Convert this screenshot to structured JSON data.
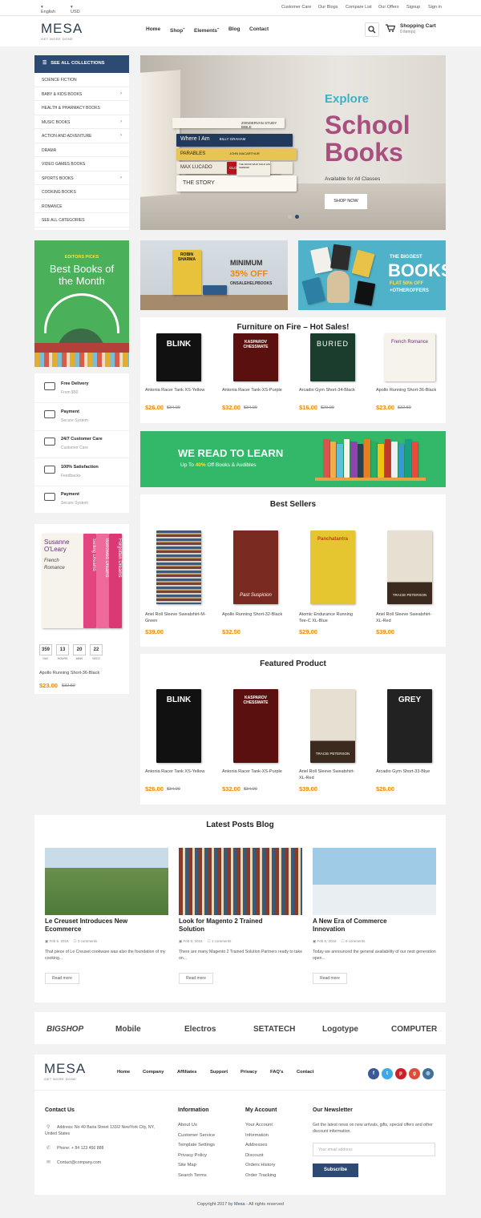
{
  "topbar": {
    "language": "English",
    "currency": "USD",
    "links": [
      "Customer Care",
      "Our Blogs",
      "Compare List",
      "Our Offers",
      "Signup",
      "Sign in"
    ]
  },
  "header": {
    "logo": "MESA",
    "tagline": "GET MORE DONE",
    "nav": [
      "Home",
      "Shop",
      "Elements",
      "Blog",
      "Contact"
    ],
    "cart_title": "Shopping Cart",
    "cart_items": "0 item(s)"
  },
  "sidebar": {
    "header": "SEE ALL COLLECTIONS",
    "categories": [
      {
        "label": "SCIENCE FICTION",
        "arrow": false
      },
      {
        "label": "BABY & KIDS BOOKS",
        "arrow": true
      },
      {
        "label": "HEALTH & PHARMACY BOOKS",
        "arrow": false
      },
      {
        "label": "MUSIC BOOKS",
        "arrow": true
      },
      {
        "label": "ACTION AND ADVENTURE",
        "arrow": true
      },
      {
        "label": "DRAMA",
        "arrow": false
      },
      {
        "label": "VIDEO GAMES BOOKS",
        "arrow": false
      },
      {
        "label": "SPORTS BOOKS",
        "arrow": true
      },
      {
        "label": "COOKING BOOKS",
        "arrow": false
      },
      {
        "label": "ROMANCE",
        "arrow": false
      },
      {
        "label": "SEE ALL CATEGORIES",
        "arrow": false
      }
    ]
  },
  "hero": {
    "line1": "Explore",
    "line2": "School",
    "line3": "Books",
    "sub": "Available for All Classes",
    "button": "SHOP NOW",
    "spines": [
      "ZONDERVAN STUDY BIBLE",
      "Where I Am",
      "BILLY GRAHAM",
      "PARABLES",
      "JOHN MACARTHUR",
      "MAX LUCADO",
      "GLORY DAYS",
      "THE STORY",
      "THE MONK WHO SOLD HIS FERRARI"
    ]
  },
  "editors": {
    "kicker": "EDITORS PICKS",
    "title": "Best Books of the Month"
  },
  "banner1": {
    "author": "ROBIN SHARMA",
    "line1": "MINIMUM",
    "line2": "35% OFF",
    "line3": "ONSALEHELPBOOKS"
  },
  "banner2": {
    "line1": "THE BIGGEST",
    "line2": "BOOKS",
    "line3": "FLAT 50% OFF",
    "line4": "+OTHEROFFERS"
  },
  "services": [
    {
      "title": "Free Delivery",
      "sub": "From $50",
      "icon": "truck-icon"
    },
    {
      "title": "Payment",
      "sub": "Secure System",
      "icon": "shield-icon"
    },
    {
      "title": "24/7 Customer Care",
      "sub": "Customer Care",
      "icon": "monitor-icon"
    },
    {
      "title": "100% Satisfaction",
      "sub": "Feedbacks",
      "icon": "chat-icon"
    },
    {
      "title": "Payment",
      "sub": "Secure System",
      "icon": "thumbs-up-icon"
    }
  ],
  "deal": {
    "cover_author": "Susanne O'Leary",
    "cover_title": "French Romance",
    "spines": [
      "Selling Dreams",
      "Borrowed Dreams",
      "Forgotten Dreams"
    ],
    "days": "359",
    "hours": "13",
    "mins": "20",
    "secs": "22",
    "lbl_day": "DAY",
    "lbl_hours": "HOURS",
    "lbl_mins": "MINS",
    "lbl_secs": "SECS",
    "name": "Apollo Running Short-36-Black",
    "price": "$23.00",
    "old": "$32.50"
  },
  "hot": {
    "title": "Furniture on Fire – Hot Sales!",
    "products": [
      {
        "name": "Antonia Racer Tank XS-Yellow",
        "price": "$26.00",
        "old": "$34.00",
        "cover": "BLINK"
      },
      {
        "name": "Antonia Racer Tank-XS-Purple",
        "price": "$32.00",
        "old": "$34.00",
        "cover": "KASPAROV CHESSMATE"
      },
      {
        "name": "Arcadio Gym Short-34-Black",
        "price": "$16.00",
        "old": "$29.00",
        "cover": "BURIED"
      },
      {
        "name": "Apollo Running Short-36-Black",
        "price": "$23.00",
        "old": "$32.50",
        "cover": "French Romance"
      }
    ]
  },
  "promo": {
    "title": "WE READ TO LEARN",
    "sub_prefix": "Up To",
    "sub_pct": "40%",
    "sub_suffix": "Off Books & Audibles"
  },
  "best": {
    "title": "Best Sellers",
    "products": [
      {
        "name": "Ariel Roll Sleeve Sweatshirt-M-Green",
        "price": "$39.00"
      },
      {
        "name": "Apollo Running Short-32-Black",
        "price": "$32.50",
        "cover": "Past Suspicion",
        "author": "THERESE HECKENKAMP"
      },
      {
        "name": "Atomic Endurance Running Tee-C XL-Blue",
        "price": "$29.00",
        "cover": "Panchatantra"
      },
      {
        "name": "Ariel Roll Sleeve Sweatshirt-XL-Red",
        "price": "$39.00",
        "author": "TRACIE PETERSON"
      }
    ]
  },
  "featured": {
    "title": "Featured Product",
    "products": [
      {
        "name": "Antonia Racer Tank XS-Yellow",
        "price": "$26.00",
        "old": "$34.00",
        "cover": "BLINK"
      },
      {
        "name": "Antonia Racer Tank-XS-Purple",
        "price": "$32.00",
        "old": "$34.00",
        "cover": "KASPAROV CHESSMATE"
      },
      {
        "name": "Ariel Roll Sleeve Sweatshirt-XL-Red",
        "price": "$39.00",
        "author": "TRACIE PETERSON"
      },
      {
        "name": "Arcadio Gym Short-33-Blue",
        "price": "$26.00",
        "cover": "GREY"
      }
    ]
  },
  "blog": {
    "title": "Latest Posts Blog",
    "read_more": "Read more",
    "posts": [
      {
        "title": "Le Creuset Introduces New Ecommerce",
        "date": "Feb 5, 2016",
        "comments": "3 comments",
        "excerpt": "That piece of Le Creuset cookware was also the foundation of my cooking..."
      },
      {
        "title": "Look for Magento 2 Trained Solution",
        "date": "Feb 5, 2016",
        "comments": "1 comments",
        "excerpt": "There are many Magento 2 Trained Solution Partners ready to take on..."
      },
      {
        "title": "A New Era of Commerce Innovation",
        "date": "Feb 5, 2016",
        "comments": "0 comments",
        "excerpt": "Today we announced the general availability of our next generation open..."
      }
    ]
  },
  "brands": [
    "BIGSHOP",
    "Mobile",
    "Electros",
    "SETATECH",
    "Logotype",
    "COMPUTER"
  ],
  "footer": {
    "nav": [
      "Home",
      "Company",
      "Affiliates",
      "Support",
      "Privacy",
      "FAQ's",
      "Contact"
    ],
    "contact_h": "Contact Us",
    "address": "Address: No 40 Baria Street 133/2 NewYork City, NY, United States",
    "phone": "Phone: + 84 123 456 888",
    "email": "Contact@company.com",
    "info_h": "Information",
    "info": [
      "About Us",
      "Customer Service",
      "Template Settings",
      "Privacy Policy",
      "Site Map",
      "Search Terms"
    ],
    "account_h": "My Account",
    "account": [
      "Your Account",
      "Information",
      "Addresses",
      "Discount",
      "Orders History",
      "Order Tracking"
    ],
    "news_h": "Our Newsletter",
    "news_text": "Get the latest news on new arrivals, gifts, special offers and other discount information.",
    "news_placeholder": "Your email address",
    "subscribe": "Subscribe",
    "copyright_prefix": "Copyright 2017 by",
    "copyright_brand": "Mesa",
    "copyright_suffix": "- All rights reserved"
  },
  "colors": {
    "accent": "#e8890c",
    "nav_blue": "#2d4a73",
    "green": "#4ab05a"
  }
}
